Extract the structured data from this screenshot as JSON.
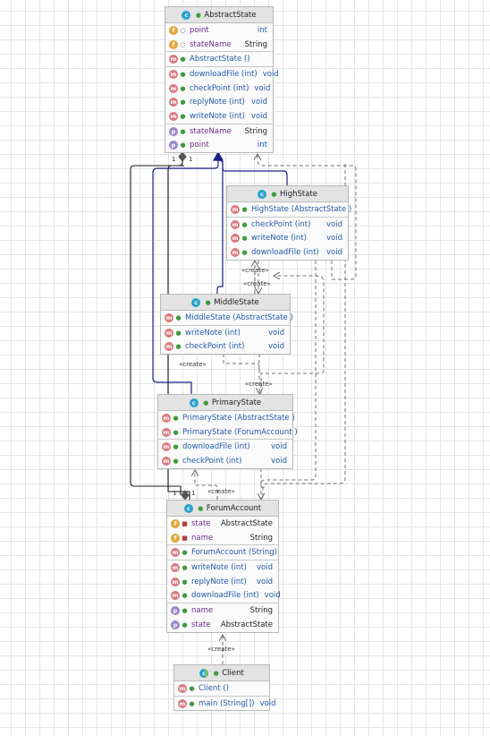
{
  "classes": {
    "abstract_state": {
      "name": "AbstractState",
      "fields": [
        {
          "name": "point",
          "type": "int"
        },
        {
          "name": "stateName",
          "type": "String"
        }
      ],
      "constructors": [
        {
          "name": "AbstractState ()"
        }
      ],
      "methods": [
        {
          "name": "downloadFile (int)",
          "type": "void"
        },
        {
          "name": "checkPoint (int)",
          "type": "void"
        },
        {
          "name": "replyNote (int)",
          "type": "void"
        },
        {
          "name": "writeNote (int)",
          "type": "void"
        }
      ],
      "properties": [
        {
          "name": "stateName",
          "type": "String"
        },
        {
          "name": "point",
          "type": "int"
        }
      ]
    },
    "high_state": {
      "name": "HighState",
      "constructors": [
        {
          "name": "HighState (AbstractState )"
        }
      ],
      "methods": [
        {
          "name": "checkPoint (int)",
          "type": "void"
        },
        {
          "name": "writeNote (int)",
          "type": "void"
        },
        {
          "name": "downloadFile  (int)",
          "type": "void"
        }
      ]
    },
    "middle_state": {
      "name": "MiddleState",
      "constructors": [
        {
          "name": "MiddleState (AbstractState )"
        }
      ],
      "methods": [
        {
          "name": "writeNote (int)",
          "type": "void"
        },
        {
          "name": "checkPoint (int)",
          "type": "void"
        }
      ]
    },
    "primary_state": {
      "name": "PrimaryState",
      "constructors": [
        {
          "name": "PrimaryState (AbstractState )"
        },
        {
          "name": "PrimaryState (ForumAccount )"
        }
      ],
      "methods": [
        {
          "name": "downloadFile  (int)",
          "type": "void"
        },
        {
          "name": "checkPoint (int)",
          "type": "void"
        }
      ]
    },
    "forum_account": {
      "name": "ForumAccount",
      "fields": [
        {
          "name": "state",
          "type": "AbstractState"
        },
        {
          "name": "name",
          "type": "String"
        }
      ],
      "constructors": [
        {
          "name": "ForumAccount (String)"
        }
      ],
      "methods": [
        {
          "name": "writeNote (int)",
          "type": "void"
        },
        {
          "name": "replyNote (int)",
          "type": "void"
        },
        {
          "name": "downloadFile  (int)",
          "type": "void"
        }
      ],
      "properties": [
        {
          "name": "name",
          "type": "String"
        },
        {
          "name": "state",
          "type": "AbstractState"
        }
      ]
    },
    "client": {
      "name": "Client",
      "constructors": [
        {
          "name": "Client ()"
        }
      ],
      "methods": [
        {
          "name": "main (String[])",
          "type": "void"
        }
      ]
    }
  },
  "labels": {
    "create": "«create»",
    "mult_one": "1"
  },
  "colors": {
    "inheritance": "#1c1f84",
    "association": "#1a1a1a",
    "dependency": "#707070"
  },
  "icons": {
    "class": "class-icon",
    "field": "field-icon",
    "method": "method-icon",
    "property": "property-icon"
  }
}
